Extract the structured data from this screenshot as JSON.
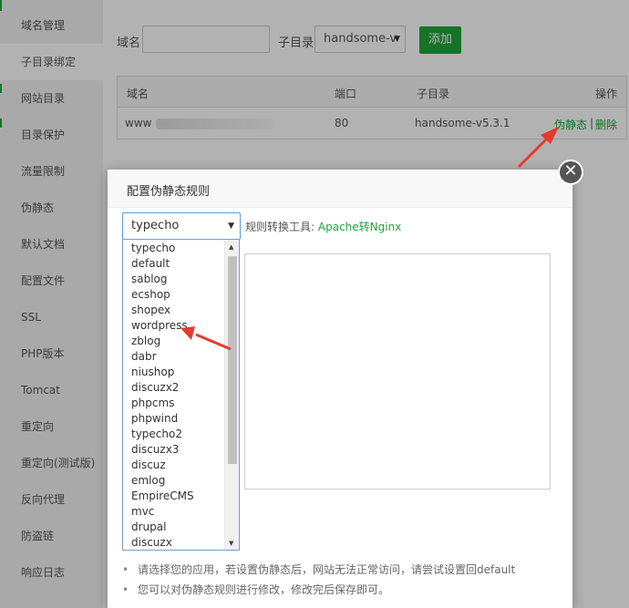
{
  "sidebar": {
    "items": [
      {
        "label": "域名管理"
      },
      {
        "label": "子目录绑定"
      },
      {
        "label": "网站目录"
      },
      {
        "label": "目录保护"
      },
      {
        "label": "流量限制"
      },
      {
        "label": "伪静态"
      },
      {
        "label": "默认文档"
      },
      {
        "label": "配置文件"
      },
      {
        "label": "SSL"
      },
      {
        "label": "PHP版本"
      },
      {
        "label": "Tomcat"
      },
      {
        "label": "重定向"
      },
      {
        "label": "重定向(测试版)"
      },
      {
        "label": "反向代理"
      },
      {
        "label": "防盗链"
      },
      {
        "label": "响应日志"
      }
    ]
  },
  "form": {
    "domain_label": "域名",
    "domain_value": "",
    "subdir_label": "子目录",
    "subdir_value": "handsome-v",
    "add_button": "添加"
  },
  "table": {
    "headers": {
      "domain": "域名",
      "port": "端口",
      "subdir": "子目录",
      "action": "操作"
    },
    "rows": [
      {
        "domain": "www",
        "port": "80",
        "subdir": "handsome-v5.3.1",
        "action_rewrite": "伪静态",
        "separator": "|",
        "action_delete": "删除"
      }
    ]
  },
  "modal": {
    "title": "配置伪静态规则",
    "close_icon": "✕",
    "select_value": "typecho",
    "tool_label": "规则转换工具:",
    "tool_link": "Apache转Nginx",
    "textarea_value": "",
    "options": [
      "typecho",
      "default",
      "sablog",
      "ecshop",
      "shopex",
      "wordpress",
      "zblog",
      "dabr",
      "niushop",
      "discuzx2",
      "phpcms",
      "phpwind",
      "typecho2",
      "discuzx3",
      "discuz",
      "emlog",
      "EmpireCMS",
      "mvc",
      "drupal",
      "discuzx"
    ],
    "tips": [
      "请选择您的应用，若设置伪静态后，网站无法正常访问，请尝试设置回default",
      "您可以对伪静态规则进行修改，修改完后保存即可。"
    ]
  },
  "colors": {
    "accent": "#20a53a",
    "annotation_arrow": "#e8392f"
  }
}
